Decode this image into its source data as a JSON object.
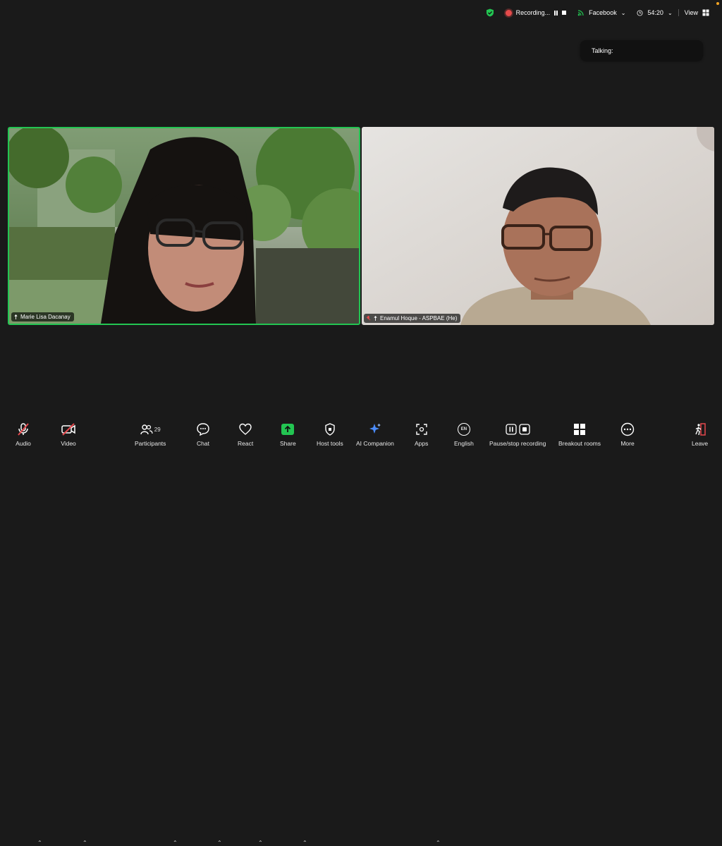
{
  "status_bar": {
    "recording_label": "Recording...",
    "stream_label": "Facebook",
    "timer": "54:20",
    "view_label": "View"
  },
  "talking_label": "Talking:",
  "participants_tiles": [
    {
      "name": "Marie Lisa Dacanay"
    },
    {
      "name": "Enamul Hoque - ASPBAE (He)"
    }
  ],
  "toolbar": {
    "audio": "Audio",
    "video": "Video",
    "participants": "Participants",
    "participants_count": "29",
    "chat": "Chat",
    "react": "React",
    "share": "Share",
    "host_tools": "Host tools",
    "ai_companion": "AI Companion",
    "apps": "Apps",
    "language": "English",
    "language_badge": "EN",
    "recording": "Pause/stop recording",
    "breakout": "Breakout rooms",
    "more": "More",
    "leave": "Leave"
  },
  "colors": {
    "background": "#1a1a1a",
    "active_speaker_border": "#23c552",
    "recording_red": "#e54b4b",
    "share_green": "#23c552",
    "leave_red": "#e5484d"
  }
}
